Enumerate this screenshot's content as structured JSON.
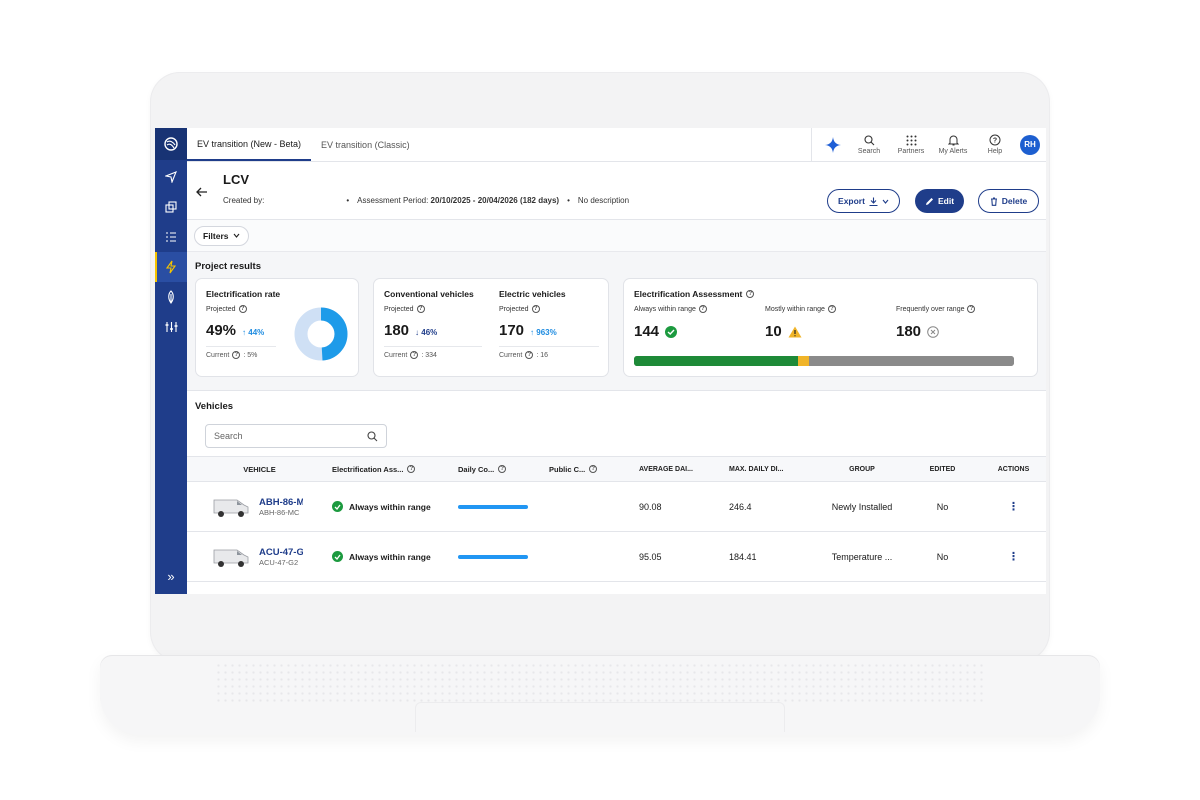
{
  "tabs": [
    {
      "label": "EV transition (New - Beta)",
      "active": true
    },
    {
      "label": "EV transition (Classic)",
      "active": false
    }
  ],
  "toolbar": {
    "search_label": "Search",
    "partners_label": "Partners",
    "alerts_label": "My Alerts",
    "help_label": "Help",
    "avatar_initials": "RH"
  },
  "header": {
    "title": "LCV",
    "created_by_label": "Created by:",
    "assessment_label": "Assessment Period:",
    "assessment_value": "20/10/2025 - 20/04/2026 (182 days)",
    "description": "No description",
    "export_label": "Export",
    "edit_label": "Edit",
    "delete_label": "Delete"
  },
  "filters_label": "Filters",
  "project_results": {
    "title": "Project results",
    "electrification_rate": {
      "title": "Electrification rate",
      "projected_label": "Projected",
      "value": "49%",
      "delta": "44%",
      "current_label": "Current",
      "current_value": ": 5%",
      "donut_fraction": 0.49
    },
    "conventional": {
      "title": "Conventional vehicles",
      "projected_label": "Projected",
      "value": "180",
      "delta": "46%",
      "current_label": "Current",
      "current_value": ": 334"
    },
    "electric": {
      "title": "Electric vehicles",
      "projected_label": "Projected",
      "value": "170",
      "delta": "963%",
      "current_label": "Current",
      "current_value": ": 16"
    },
    "assessment": {
      "title": "Electrification Assessment",
      "always_label": "Always within range",
      "always_value": "144",
      "mostly_label": "Mostly within range",
      "mostly_value": "10",
      "frequent_label": "Frequently over range",
      "frequent_value": "180",
      "bar_fractions": {
        "always": 0.431,
        "mostly": 0.03,
        "frequent": 0.539
      },
      "colors": {
        "always": "#1e8a38",
        "mostly": "#f0b429",
        "frequent": "#8a8a8a"
      }
    }
  },
  "vehicles": {
    "title": "Vehicles",
    "search_placeholder": "Search",
    "columns": [
      "VEHICLE",
      "Electrification Ass...",
      "Daily Co...",
      "Public C...",
      "AVERAGE DAI...",
      "MAX. DAILY DI...",
      "GROUP",
      "EDITED",
      "ACTIONS"
    ],
    "rows": [
      {
        "id": "ABH-86-M",
        "sub": "ABH-86-MC",
        "electrification": "Always within range",
        "daily_fraction": 1.0,
        "average": "90.08",
        "max": "246.4",
        "group": "Newly Installed",
        "edited": "No"
      },
      {
        "id": "ACU-47-G",
        "sub": "ACU-47-G2",
        "electrification": "Always within range",
        "daily_fraction": 1.0,
        "average": "95.05",
        "max": "184.41",
        "group": "Temperature ...",
        "edited": "No"
      }
    ]
  },
  "colors": {
    "brand": "#1f3d8a",
    "accent": "#1d5fd0",
    "success": "#1c9a3f",
    "warning": "#f0b429",
    "donut_fill": "#1e9be9",
    "donut_rest": "#cfe0f5"
  }
}
